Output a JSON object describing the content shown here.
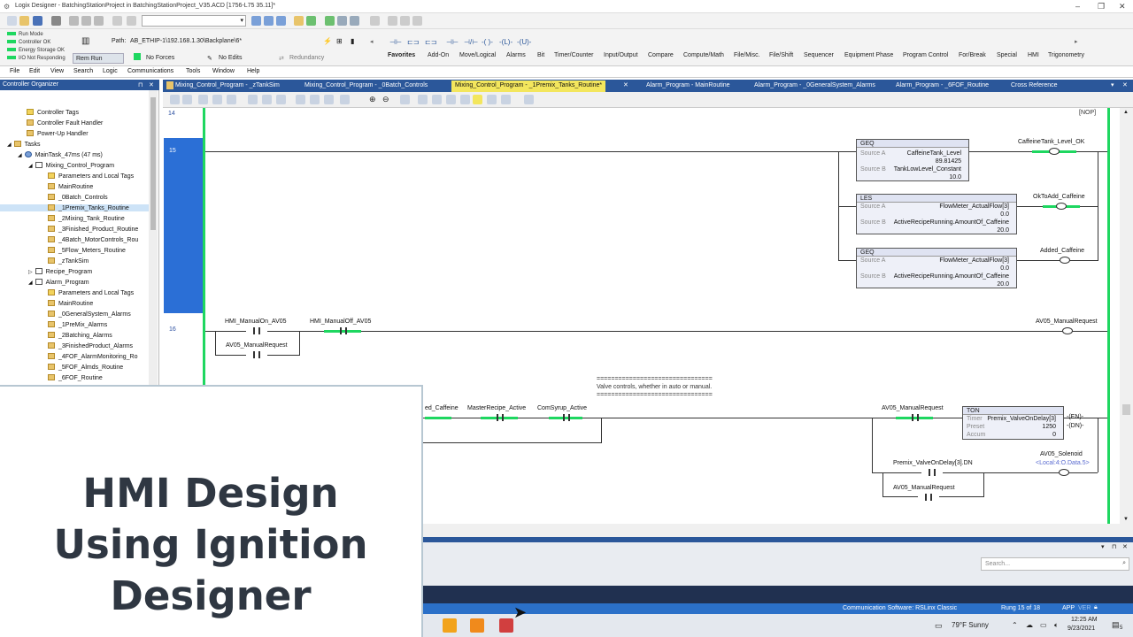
{
  "window": {
    "title": "Logix Designer - BatchingStationProject in BatchingStationProject_V35.ACD [1756-L75 35.11]*"
  },
  "status": {
    "run_mode": "Run Mode",
    "controller_ok": "Controller OK",
    "energy": "Energy Storage OK",
    "io": "I/O Not Responding",
    "mode_box": "Rem Run",
    "forces": "No Forces",
    "edits": "No Edits",
    "redundancy": "Redundancy",
    "path_label": "Path:",
    "path": "AB_ETHIP-1\\192.168.1.30\\Backplane\\6*"
  },
  "instr_tabs": [
    "Favorites",
    "Add-On",
    "Move/Logical",
    "Alarms",
    "Bit",
    "Timer/Counter",
    "Input/Output",
    "Compare",
    "Compute/Math",
    "File/Misc.",
    "File/Shift",
    "Sequencer",
    "Equipment Phase",
    "Program Control",
    "For/Break",
    "Special",
    "HMI",
    "Trigonometry"
  ],
  "menu": [
    "File",
    "Edit",
    "View",
    "Search",
    "Logic",
    "Communications",
    "Tools",
    "Window",
    "Help"
  ],
  "organizer": {
    "title": "Controller Organizer",
    "items": [
      "Controller Tags",
      "Controller Fault Handler",
      "Power-Up Handler",
      "Tasks",
      "MainTask_47ms (47 ms)",
      "Mixing_Control_Program",
      "Parameters and Local Tags",
      "MainRoutine",
      "_0Batch_Controls",
      "_1Premix_Tanks_Routine",
      "_2Mixing_Tank_Routine",
      "_3Finished_Product_Routine",
      "_4Batch_MotorControls_Rou",
      "_5Flow_Meters_Routine",
      "_zTankSim",
      "Recipe_Program",
      "Alarm_Program",
      "Parameters and Local Tags",
      "MainRoutine",
      "_0GeneralSystem_Alarms",
      "_1PreMix_Alarms",
      "_2Batching_Alarms",
      "_3FinishedProduct_Alarms",
      "_4FOF_AlarmMonitoring_Ro",
      "_5FOF_Almds_Routine",
      "_6FOF_Routine"
    ]
  },
  "editor_tabs": [
    "Mixing_Control_Program - _zTankSim",
    "Mixing_Control_Program - _0Batch_Controls",
    "Mixing_Control_Program - _1Premix_Tanks_Routine*",
    "Alarm_Program - MainRoutine",
    "Alarm_Program - _0GeneralSystem_Alarms",
    "Alarm_Program - _6FOF_Routine",
    "Cross Reference"
  ],
  "ladder": {
    "rung14": "14",
    "rung15": "15",
    "rung16": "16",
    "nop": "NOP",
    "geq1": {
      "op": "GEQ",
      "src_a_lbl": "Source A",
      "src_a": "CaffeineTank_Level",
      "src_a_val": "89.81425",
      "src_b_lbl": "Source B",
      "src_b": "TankLowLevel_Constant",
      "src_b_val": "10.0"
    },
    "les": {
      "op": "LES",
      "src_a_lbl": "Source A",
      "src_a": "FlowMeter_ActualFlow[3]",
      "src_a_val": "0.0",
      "src_b_lbl": "Source B",
      "src_b": "ActiveRecipeRunning.AmountOf_Caffeine",
      "src_b_val": "20.0"
    },
    "geq2": {
      "op": "GEQ",
      "src_a_lbl": "Source A",
      "src_a": "FlowMeter_ActualFlow[3]",
      "src_a_val": "0.0",
      "src_b_lbl": "Source B",
      "src_b": "ActiveRecipeRunning.AmountOf_Caffeine",
      "src_b_val": "20.0"
    },
    "coil1": "CaffeineTank_Level_OK",
    "coil2": "OkToAdd_Caffeine",
    "coil3": "Added_Caffeine",
    "r16_c1": "HMI_ManualOn_AV05",
    "r16_c2": "HMI_ManualOff_AV05",
    "r16_branch": "AV05_ManualRequest",
    "r16_coil": "AV05_ManualRequest",
    "comment_bar": "================================",
    "comment": "Valve controls, whether in auto or manual.",
    "r17_c1": "ed_Caffeine",
    "r17_c2": "MasterRecipe_Active",
    "r17_c3": "ComSyrup_Active",
    "r17_c4": "AV05_ManualRequest",
    "ton": {
      "op": "TON",
      "timer_lbl": "Timer",
      "timer": "Premix_ValveOnDelay[3]",
      "preset_lbl": "Preset",
      "preset": "1250",
      "accum_lbl": "Accum",
      "accum": "0",
      "en": "EN",
      "dn": "DN"
    },
    "r17_b1": "Premix_ValveOnDelay[3].DN",
    "r17_b2": "AV05_ManualRequest",
    "sol": "AV05_Solenoid",
    "sol_addr": "<Local:4:O.Data.5>"
  },
  "search": {
    "placeholder": "Search..."
  },
  "statusbar": {
    "comm": "Communication Software: RSLinx Classic",
    "rung": "Rung 15 of 18",
    "app": "APP",
    "ver": "VER"
  },
  "taskbar": {
    "weather": "79°F  Sunny",
    "time": "12:25 AM",
    "date": "9/23/2021",
    "notif": "5"
  },
  "overlay": {
    "title": "HMI Design Using Ignition Designer"
  }
}
